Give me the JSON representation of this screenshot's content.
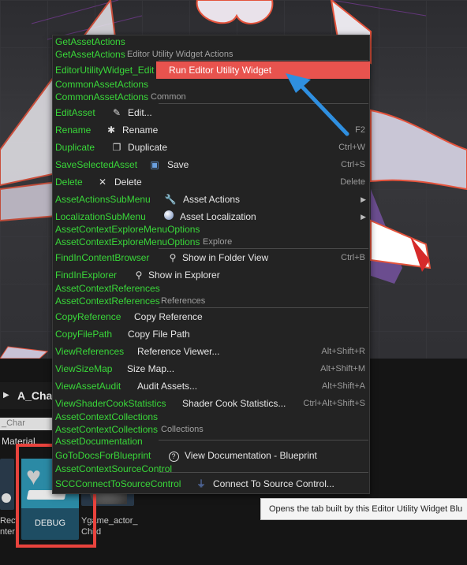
{
  "menu": {
    "section_editor_utility": {
      "debug_a": "GetAssetActions",
      "debug_b": "GetAssetActions",
      "title": "Editor Utility Widget Actions"
    },
    "run_widget": {
      "debug": "EditorUtilityWidget_Edit",
      "label": "Run Editor Utility Widget"
    },
    "section_common": {
      "debug_a": "CommonAssetActions",
      "debug_b": "CommonAssetActions",
      "title": "Common"
    },
    "items_common": [
      {
        "debug": "EditAsset",
        "icon": "pencil-icon",
        "label": "Edit...",
        "shortcut": ""
      },
      {
        "debug": "Rename",
        "icon": "rename-star-icon",
        "label": "Rename",
        "shortcut": "F2"
      },
      {
        "debug": "Duplicate",
        "icon": "duplicate-icon",
        "label": "Duplicate",
        "shortcut": "Ctrl+W"
      },
      {
        "debug": "SaveSelectedAsset",
        "icon": "save-floppy-icon",
        "label": "Save",
        "shortcut": "Ctrl+S"
      },
      {
        "debug": "Delete",
        "icon": "close-x-icon",
        "label": "Delete",
        "shortcut": "Delete"
      },
      {
        "debug": "AssetActionsSubMenu",
        "icon": "wrench-icon",
        "label": "Asset Actions",
        "shortcut": ""
      },
      {
        "debug": "LocalizationSubMenu",
        "icon": "globe-icon",
        "label": "Asset Localization",
        "shortcut": ""
      }
    ],
    "section_explore": {
      "debug_a": "AssetContextExploreMenuOptions",
      "debug_b": "AssetContextExploreMenuOptions",
      "title": "Explore"
    },
    "items_explore": [
      {
        "debug": "FindInContentBrowser",
        "icon": "magnifier-icon",
        "label": "Show in Folder View",
        "shortcut": "Ctrl+B"
      },
      {
        "debug": "FindInExplorer",
        "icon": "magnifier-icon",
        "label": "Show in Explorer",
        "shortcut": ""
      }
    ],
    "section_references": {
      "debug_a": "AssetContextReferences",
      "debug_b": "AssetContextReferences",
      "title": "References"
    },
    "items_references": [
      {
        "debug": "CopyReference",
        "label": "Copy Reference",
        "shortcut": ""
      },
      {
        "debug": "CopyFilePath",
        "label": "Copy File Path",
        "shortcut": ""
      },
      {
        "debug": "ViewReferences",
        "label": "Reference Viewer...",
        "shortcut": "Alt+Shift+R"
      },
      {
        "debug": "ViewSizeMap",
        "label": "Size Map...",
        "shortcut": "Alt+Shift+M"
      },
      {
        "debug": "ViewAssetAudit",
        "label": "Audit Assets...",
        "shortcut": "Alt+Shift+A"
      },
      {
        "debug": "ViewShaderCookStatistics",
        "label": "Shader Cook Statistics...",
        "shortcut": "Ctrl+Alt+Shift+S"
      }
    ],
    "section_collections": {
      "debug_a": "AssetContextCollections",
      "debug_b": "AssetContextCollections",
      "title": "Collections"
    },
    "doc_debug": "AssetDocumentation",
    "doc_item": {
      "debug": "GoToDocsForBlueprint",
      "icon": "help-circle-icon",
      "label": "View Documentation - Blueprint"
    },
    "section_source_control": {
      "debug": "AssetContextSourceControl"
    },
    "source_control_item": {
      "debug": "SCCConnectToSourceControl",
      "icon": "plug-icon",
      "label": "Connect To Source Control..."
    }
  },
  "tooltip": {
    "text": "Opens the tab built by this Editor Utility Widget Blu"
  },
  "content_browser": {
    "folder_title": "A_Char",
    "path_text": "_Char",
    "filter_text": "Material",
    "assets": [
      {
        "name": "Rect\nnter"
      },
      {
        "name": "DEBUG"
      },
      {
        "name": "Ygame_actor_\nChild"
      }
    ]
  },
  "colors": {
    "highlight": "#e8534e",
    "debug_text": "#39d739",
    "annotation_arrow": "#2f8fe0",
    "annotation_box": "#e8433d"
  }
}
